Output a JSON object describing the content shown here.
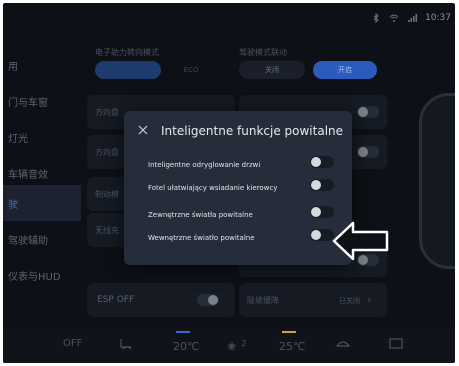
{
  "status_bar": {
    "time": "10:37",
    "icons": [
      "bluetooth-icon",
      "wifi-icon",
      "signal-icon"
    ]
  },
  "sidebar": {
    "items": [
      {
        "label": "用"
      },
      {
        "label": "门与车窗"
      },
      {
        "label": "灯光"
      },
      {
        "label": "车辆音效"
      },
      {
        "label": "驶"
      },
      {
        "label": "驾驶辅助"
      },
      {
        "label": "仪表与HUD"
      },
      {
        "label": ""
      }
    ]
  },
  "main": {
    "steering_label": "电子助力转向模式",
    "steering_option2": "ECO",
    "steering_option1": "",
    "row2_label": "方向盘",
    "row3_label": "方向盘",
    "drive_mode_label": "驾驶模式联动",
    "drive_mode_off": "关闭",
    "drive_mode_on": "开启",
    "row4_label": "制动模",
    "row5_label": "无线充",
    "esp_label": "ESP OFF",
    "hill_label": "陡坡缓降",
    "hill_status": "已关闭"
  },
  "bottom_bar": {
    "off": "OFF",
    "temp_left": "20℃",
    "fan_level": "2",
    "temp_right": "25℃"
  },
  "dialog": {
    "title": "Inteligentne funkcje powitalne",
    "options": [
      {
        "label": "Inteligentne odryglowanie drzwi",
        "on": false
      },
      {
        "label": "Fotel ułatwiający wsiadanie kierowcy",
        "on": false
      },
      {
        "label": "Zewnętrzne światła powitalne",
        "on": false
      },
      {
        "label": "Wewnętrzne światło powitalne",
        "on": false
      }
    ]
  },
  "colors": {
    "screen_bg": "#0d1016",
    "dialog_bg": "#262d3a",
    "accent_blue": "#3f6bd8",
    "temp_left_accent": "#3a66d8",
    "temp_right_accent": "#d9a13a"
  }
}
